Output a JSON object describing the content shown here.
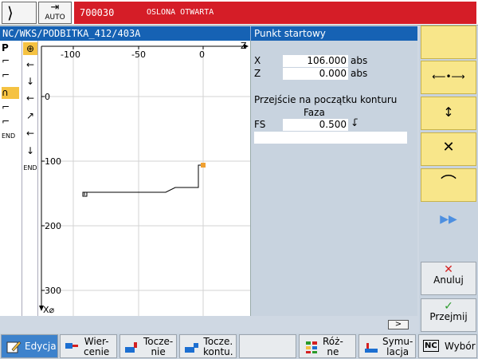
{
  "alarm_bar": {
    "mode_glyph": "⟩",
    "auto_icon": "⇥",
    "auto_label": "AUTO",
    "alarm_number": "700030",
    "alarm_text": "OSLONA OTWARTA"
  },
  "header": {
    "path": "NC/WKS/PODBITKA_412/403A",
    "form_title": "Punkt startowy"
  },
  "left_strip": {
    "items": [
      "P",
      "⌐",
      "⌐",
      "∩",
      "⌐",
      "⌐",
      "END"
    ],
    "steps": [
      "⊕",
      "←",
      "↓",
      "←",
      "↗",
      "←",
      "↓",
      "END"
    ],
    "selected_step": 0
  },
  "graphic": {
    "x_ticks": [
      "-100",
      "-50",
      "0"
    ],
    "y_ticks": [
      "0",
      "100",
      "200",
      "300"
    ],
    "z_axis_label": "Z",
    "x_axis_label": "X⌀",
    "start_point_color": "#f0a030"
  },
  "form": {
    "x_label": "X",
    "x_value": "106.000",
    "x_unit": "abs",
    "z_label": "Z",
    "z_value": "0.000",
    "z_unit": "abs",
    "transition_label": "Przejście na początku konturu",
    "transition_type": "Faza",
    "fs_label": "FS",
    "fs_value": "0.500",
    "fs_marker": "↓̄"
  },
  "soft_keys_vertical": {
    "k2_icon": "⟵•⟶",
    "k3_icon": "↕",
    "k4_icon": "✕",
    "k5_icon": "⌒",
    "k6_icon": "▶▶",
    "cancel_icon": "✕",
    "cancel_label": "Anuluj",
    "accept_icon": "✓",
    "accept_label": "Przejmij",
    "accent_color": "#f8e68a"
  },
  "soft_keys_horizontal": {
    "edit_label": "Edycja",
    "drilling_label": "Wier-\ncenie",
    "turning_label": "Tocze-\nnie",
    "contour_label": "Tocze.\nkontu.",
    "misc_label": "Róż-\nne",
    "simulation_label": "Symu-\nlacja",
    "select_label": "Wybór",
    "select_icon_text": "NC"
  },
  "scroll_arrow": ">"
}
